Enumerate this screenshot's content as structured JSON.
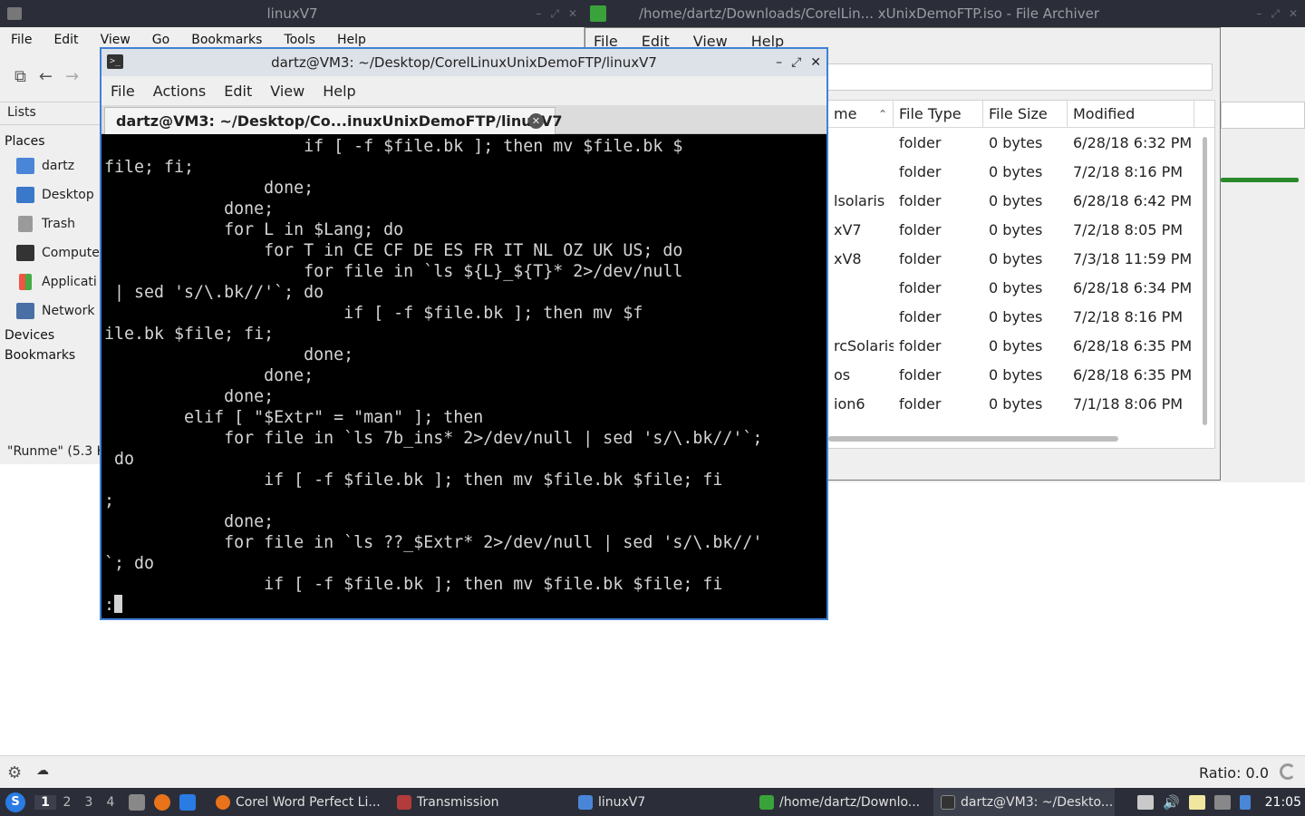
{
  "file_manager": {
    "title": "linuxV7",
    "menu": [
      "File",
      "Edit",
      "View",
      "Go",
      "Bookmarks",
      "Tools",
      "Help"
    ],
    "side_header": "Lists",
    "sections": {
      "places": "Places",
      "devices": "Devices",
      "bookmarks": "Bookmarks"
    },
    "places": [
      "dartz",
      "Desktop",
      "Trash",
      "Compute",
      "Applicati",
      "Network"
    ],
    "status": "\"Runme\" (5.3 K"
  },
  "archiver": {
    "title": "/home/dartz/Downloads/CorelLin...   xUnixDemoFTP.iso - File Archiver",
    "menu": [
      "File",
      "Edit",
      "View",
      "Help"
    ],
    "columns": [
      "me",
      "File Type",
      "File Size",
      "Modified"
    ],
    "rows": [
      [
        "",
        "folder",
        "0 bytes",
        "6/28/18 6:32 PM"
      ],
      [
        "",
        "folder",
        "0 bytes",
        "7/2/18 8:16 PM"
      ],
      [
        "lsolaris",
        "folder",
        "0 bytes",
        "6/28/18 6:42 PM"
      ],
      [
        "xV7",
        "folder",
        "0 bytes",
        "7/2/18 8:05 PM"
      ],
      [
        "xV8",
        "folder",
        "0 bytes",
        "7/3/18 11:59 PM"
      ],
      [
        "",
        "folder",
        "0 bytes",
        "6/28/18 6:34 PM"
      ],
      [
        "",
        "folder",
        "0 bytes",
        "7/2/18 8:16 PM"
      ],
      [
        "rcSolaris",
        "folder",
        "0 bytes",
        "6/28/18 6:35 PM"
      ],
      [
        "os",
        "folder",
        "0 bytes",
        "6/28/18 6:35 PM"
      ],
      [
        "ion6",
        "folder",
        "0 bytes",
        "7/1/18 8:06 PM"
      ]
    ]
  },
  "terminal": {
    "title": "dartz@VM3: ~/Desktop/CorelLinuxUnixDemoFTP/linuxV7",
    "menu": [
      "File",
      "Actions",
      "Edit",
      "View",
      "Help"
    ],
    "tab_label": "dartz@VM3: ~/Desktop/Co...inuxUnixDemoFTP/linuxV7",
    "lines": [
      "                    if [ -f $file.bk ]; then mv $file.bk $",
      "file; fi;",
      "                done;",
      "            done;",
      "            for L in $Lang; do",
      "                for T in CE CF DE ES FR IT NL OZ UK US; do",
      "                    for file in `ls ${L}_${T}* 2>/dev/null",
      " | sed 's/\\.bk//'`; do",
      "                        if [ -f $file.bk ]; then mv $f",
      "ile.bk $file; fi;",
      "                    done;",
      "                done;",
      "            done;",
      "        elif [ \"$Extr\" = \"man\" ]; then",
      "            for file in `ls 7b_ins* 2>/dev/null | sed 's/\\.bk//'`;",
      " do",
      "                if [ -f $file.bk ]; then mv $file.bk $file; fi",
      ";",
      "            done;",
      "            for file in `ls ??_$Extr* 2>/dev/null | sed 's/\\.bk//'",
      "`; do",
      "                if [ -f $file.bk ]; then mv $file.bk $file; fi",
      ":"
    ]
  },
  "statusbar": {
    "ratio": "Ratio: 0.0"
  },
  "taskbar": {
    "workspaces": [
      "1",
      "2",
      "3",
      "4"
    ],
    "tasks": [
      {
        "label": "Corel Word Perfect Li...",
        "color": "#e8731a"
      },
      {
        "label": "Transmission",
        "color": "#b23b3b"
      },
      {
        "label": "linuxV7",
        "color": "#4a86d8"
      },
      {
        "label": "/home/dartz/Downlo...",
        "color": "#3aa23a"
      },
      {
        "label": "dartz@VM3: ~/Deskto...",
        "color": "#333333"
      }
    ],
    "clock": "21:05"
  }
}
